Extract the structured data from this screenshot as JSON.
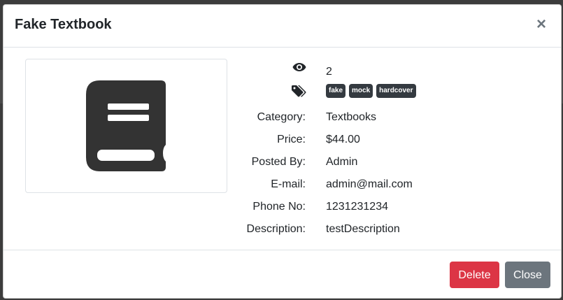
{
  "modal": {
    "title": "Fake Textbook",
    "close_symbol": "×"
  },
  "item": {
    "image_icon": "book-icon",
    "views": "2",
    "tags": [
      "fake",
      "mock",
      "hardcover"
    ],
    "details": [
      {
        "label": "Category:",
        "value": "Textbooks"
      },
      {
        "label": "Price:",
        "value": "$44.00"
      },
      {
        "label": "Posted By:",
        "value": "Admin"
      },
      {
        "label": "E-mail:",
        "value": "admin@mail.com"
      },
      {
        "label": "Phone No:",
        "value": "1231231234"
      },
      {
        "label": "Description:",
        "value": "testDescription"
      }
    ]
  },
  "footer": {
    "delete_label": "Delete",
    "close_label": "Close"
  },
  "colors": {
    "danger": "#dc3545",
    "secondary": "#6c757d",
    "dark": "#343a40"
  },
  "icons": [
    "eye-icon",
    "tags-icon",
    "book-icon",
    "close-icon"
  ]
}
